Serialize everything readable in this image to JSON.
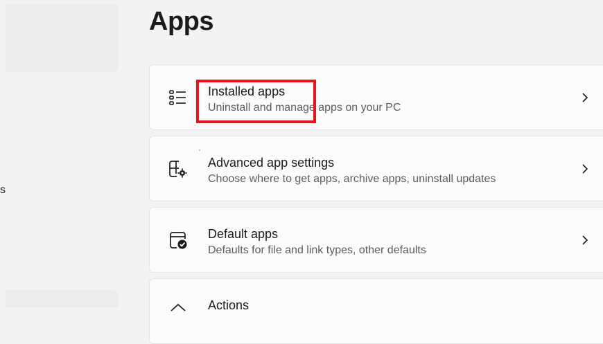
{
  "page": {
    "title": "Apps"
  },
  "sidebar": {
    "cut_text": "s"
  },
  "cards": [
    {
      "icon": "installed-apps-list-icon",
      "title": "Installed apps",
      "subtitle": "Uninstall and manage apps on your PC"
    },
    {
      "icon": "advanced-app-settings-icon",
      "title": "Advanced app settings",
      "subtitle": "Choose where to get apps, archive apps, uninstall updates"
    },
    {
      "icon": "default-apps-icon",
      "title": "Default apps",
      "subtitle": "Defaults for file and link types, other defaults"
    },
    {
      "icon": "actions-icon",
      "title": "Actions",
      "subtitle": ""
    }
  ],
  "colors": {
    "highlight": "#e8141b",
    "card_bg": "#fbfbfb",
    "page_bg": "#f3f3f3"
  }
}
